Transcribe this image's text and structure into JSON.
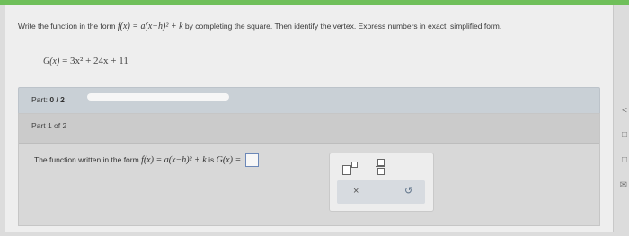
{
  "prompt": {
    "before": "Write the function in the form",
    "form": "f(x) = a(x−h)² + k",
    "after": "by completing the square. Then identify the vertex. Express numbers in exact, simplified form."
  },
  "function": {
    "lhs": "G(x)",
    "rhs": "= 3x² + 24x + 11"
  },
  "part_bar": {
    "label": "Part:",
    "value": "0 / 2",
    "progress_fraction": 0.0
  },
  "section": {
    "header": "Part 1 of 2",
    "answer_before": "The function written in the form",
    "answer_form": "f(x) = a(x−h)² + k",
    "answer_mid": "is",
    "answer_lhs": "G(x) ="
  },
  "tools": {
    "exponent_icon": "exponent-icon",
    "fraction_icon": "fraction-icon",
    "clear": "×",
    "undo": "↺"
  },
  "colors": {
    "top_accent": "#6fbf5a",
    "part_bar": "#c9d0d6"
  }
}
